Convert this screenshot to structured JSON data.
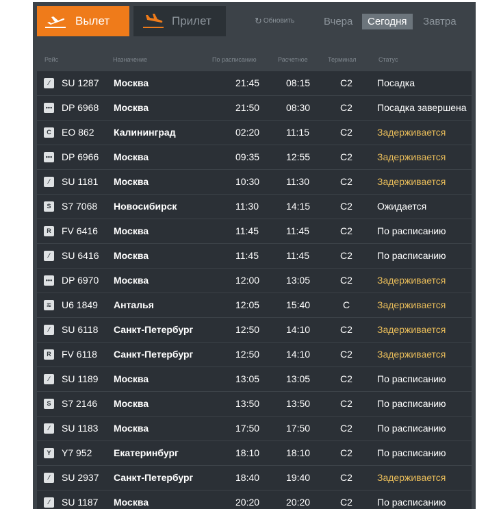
{
  "tabs": {
    "departure": "Вылет",
    "arrival": "Прилет"
  },
  "refresh_label": "Обновить",
  "days": {
    "yesterday": "Вчера",
    "today": "Сегодня",
    "tomorrow": "Завтра"
  },
  "columns": {
    "flight": "Рейс",
    "destination": "Назначение",
    "scheduled": "По расписанию",
    "estimated": "Расчетное",
    "terminal": "Терминал",
    "status": "Статус"
  },
  "colors": {
    "accent": "#ef7b1a",
    "delayed": "#e8bc5a",
    "board_bg": "#3c4248",
    "row_bg": "#2b3036"
  },
  "flights": [
    {
      "logo": "aeroflot-logo-icon",
      "flight": "SU 1287",
      "destination": "Москва",
      "scheduled": "21:45",
      "estimated": "08:15",
      "terminal": "C2",
      "status": "Посадка",
      "delayed": false
    },
    {
      "logo": "pobeda-logo-icon",
      "flight": "DP 6968",
      "destination": "Москва",
      "scheduled": "21:50",
      "estimated": "08:30",
      "terminal": "C2",
      "status": "Посадка завершена",
      "delayed": false
    },
    {
      "logo": "pegas-logo-icon",
      "flight": "EO 862",
      "destination": "Калининград",
      "scheduled": "02:20",
      "estimated": "11:15",
      "terminal": "C2",
      "status": "Задерживается",
      "delayed": true
    },
    {
      "logo": "pobeda-logo-icon",
      "flight": "DP 6966",
      "destination": "Москва",
      "scheduled": "09:35",
      "estimated": "12:55",
      "terminal": "C2",
      "status": "Задерживается",
      "delayed": true
    },
    {
      "logo": "aeroflot-logo-icon",
      "flight": "SU 1181",
      "destination": "Москва",
      "scheduled": "10:30",
      "estimated": "11:30",
      "terminal": "C2",
      "status": "Задерживается",
      "delayed": true
    },
    {
      "logo": "s7-logo-icon",
      "flight": "S7 7068",
      "destination": "Новосибирск",
      "scheduled": "11:30",
      "estimated": "14:15",
      "terminal": "C2",
      "status": "Ожидается",
      "delayed": false
    },
    {
      "logo": "rossiya-logo-icon",
      "flight": "FV 6416",
      "destination": "Москва",
      "scheduled": "11:45",
      "estimated": "11:45",
      "terminal": "C2",
      "status": "По расписанию",
      "delayed": false
    },
    {
      "logo": "aeroflot-logo-icon",
      "flight": "SU 6416",
      "destination": "Москва",
      "scheduled": "11:45",
      "estimated": "11:45",
      "terminal": "C2",
      "status": "По расписанию",
      "delayed": false
    },
    {
      "logo": "pobeda-logo-icon",
      "flight": "DP 6970",
      "destination": "Москва",
      "scheduled": "12:00",
      "estimated": "13:05",
      "terminal": "C2",
      "status": "Задерживается",
      "delayed": true
    },
    {
      "logo": "ural-logo-icon",
      "flight": "U6 1849",
      "destination": "Анталья",
      "scheduled": "12:05",
      "estimated": "15:40",
      "terminal": "C",
      "status": "Задерживается",
      "delayed": true
    },
    {
      "logo": "aeroflot-logo-icon",
      "flight": "SU 6118",
      "destination": "Санкт-Петербург",
      "scheduled": "12:50",
      "estimated": "14:10",
      "terminal": "C2",
      "status": "Задерживается",
      "delayed": true
    },
    {
      "logo": "rossiya-logo-icon",
      "flight": "FV 6118",
      "destination": "Санкт-Петербург",
      "scheduled": "12:50",
      "estimated": "14:10",
      "terminal": "C2",
      "status": "Задерживается",
      "delayed": true
    },
    {
      "logo": "aeroflot-logo-icon",
      "flight": "SU 1189",
      "destination": "Москва",
      "scheduled": "13:05",
      "estimated": "13:05",
      "terminal": "C2",
      "status": "По расписанию",
      "delayed": false
    },
    {
      "logo": "s7-logo-icon",
      "flight": "S7 2146",
      "destination": "Москва",
      "scheduled": "13:50",
      "estimated": "13:50",
      "terminal": "C2",
      "status": "По расписанию",
      "delayed": false
    },
    {
      "logo": "aeroflot-logo-icon",
      "flight": "SU 1183",
      "destination": "Москва",
      "scheduled": "17:50",
      "estimated": "17:50",
      "terminal": "C2",
      "status": "По расписанию",
      "delayed": false
    },
    {
      "logo": "nordstar-logo-icon",
      "flight": "Y7 952",
      "destination": "Екатеринбург",
      "scheduled": "18:10",
      "estimated": "18:10",
      "terminal": "C2",
      "status": "По расписанию",
      "delayed": false
    },
    {
      "logo": "aeroflot-logo-icon",
      "flight": "SU 2937",
      "destination": "Санкт-Петербург",
      "scheduled": "18:40",
      "estimated": "19:40",
      "terminal": "C2",
      "status": "Задерживается",
      "delayed": true
    },
    {
      "logo": "aeroflot-logo-icon",
      "flight": "SU 1187",
      "destination": "Москва",
      "scheduled": "20:20",
      "estimated": "20:20",
      "terminal": "C2",
      "status": "По расписанию",
      "delayed": false
    }
  ]
}
